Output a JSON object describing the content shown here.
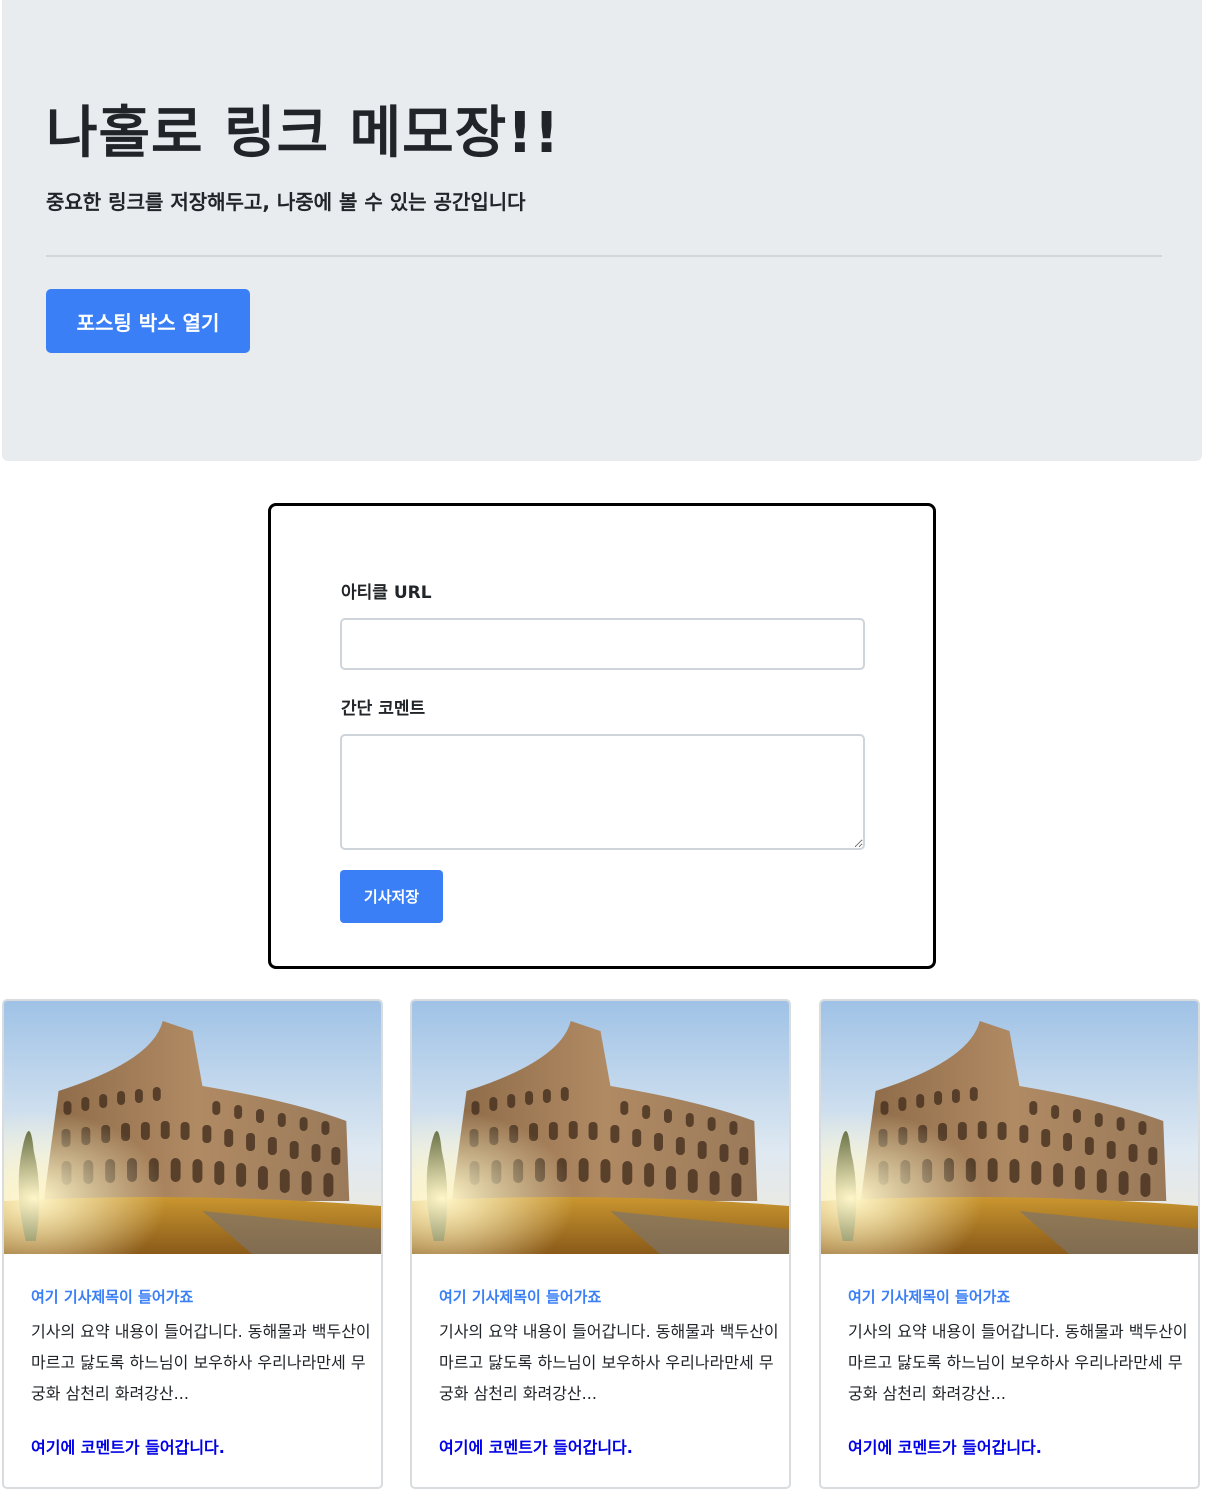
{
  "header": {
    "title": "나홀로 링크 메모장!!",
    "subtitle": "중요한 링크를 저장해두고, 나중에 볼 수 있는 공간입니다",
    "open_button_label": "포스팅 박스 열기"
  },
  "post_form": {
    "url_label": "아티클 URL",
    "url_value": "",
    "comment_label": "간단 코멘트",
    "comment_value": "",
    "save_button_label": "기사저장"
  },
  "cards": [
    {
      "image": "colosseum-photo",
      "title": "여기 기사제목이 들어가죠",
      "text": "기사의 요약 내용이 들어갑니다. 동해물과 백두산이 마르고 닳도록 하느님이 보우하사 우리나라만세 무궁화 삼천리 화려강산...",
      "comment": "여기에 코멘트가 들어갑니다."
    },
    {
      "image": "colosseum-photo",
      "title": "여기 기사제목이 들어가죠",
      "text": "기사의 요약 내용이 들어갑니다. 동해물과 백두산이 마르고 닳도록 하느님이 보우하사 우리나라만세 무궁화 삼천리 화려강산...",
      "comment": "여기에 코멘트가 들어갑니다."
    },
    {
      "image": "colosseum-photo",
      "title": "여기 기사제목이 들어가죠",
      "text": "기사의 요약 내용이 들어갑니다. 동해물과 백두산이 마르고 닳도록 하느님이 보우하사 우리나라만세 무궁화 삼천리 화려강산...",
      "comment": "여기에 코멘트가 들어갑니다."
    }
  ],
  "colors": {
    "primary": "#3a7ff6",
    "jumbotron_bg": "#e9ecef",
    "comment_text": "#0000e6"
  }
}
